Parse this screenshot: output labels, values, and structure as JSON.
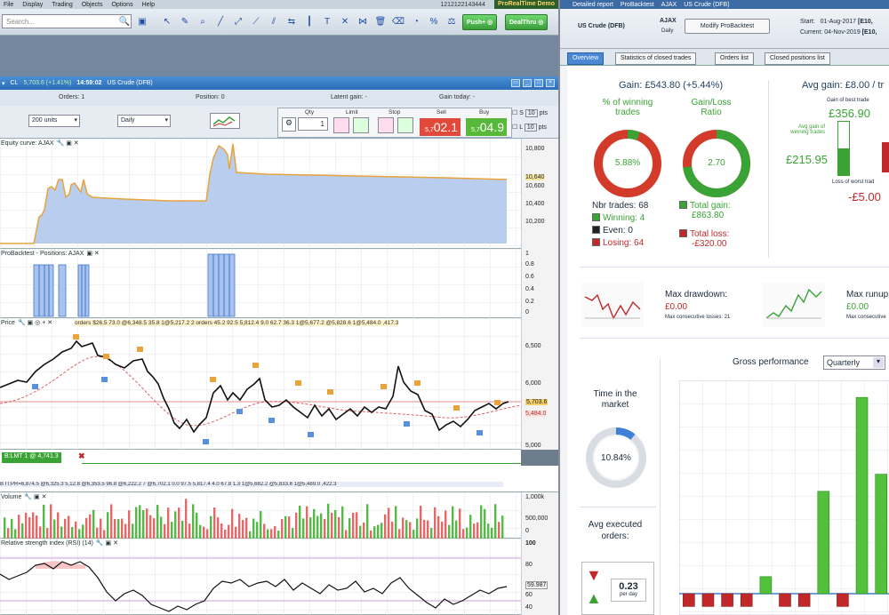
{
  "menu": {
    "items": [
      "File",
      "Display",
      "Trading",
      "Objects",
      "Options",
      "Help"
    ],
    "id": "1212122143444",
    "brand": "ProRealTime Demo"
  },
  "toolbar": {
    "search_placeholder": "Search...",
    "push_label": "Push+ ◎",
    "dealthru_label": "DealThru ◎"
  },
  "chartwin": {
    "symbol": "CL",
    "quote": "5,703.6 (+1.41%)",
    "time": "14:59:02",
    "name": "US Crude (DFB)"
  },
  "orders": {
    "orders_label": "Orders: 1",
    "position_label": "Position: 0",
    "latent_label": "Latent gain: -",
    "gaintoday_label": "Gain today: -"
  },
  "controls": {
    "units": "200 units",
    "period": "Daily"
  },
  "ticket": {
    "qty_label": "Qty",
    "limit_label": "Limit",
    "stop_label": "Stop",
    "sell_label": "Sell",
    "buy_label": "Buy",
    "qty_value": "1",
    "sell_prefix": "5,7",
    "sell_value": "02.1",
    "buy_prefix": "5,7",
    "buy_value": "04.9",
    "s_label": "S",
    "l_label": "L",
    "pts": "pts",
    "s_pts": "10",
    "l_pts": "10"
  },
  "panels": {
    "equity_title": "Equity curve: AJAX",
    "positions_title": "ProBacktest - Positions: AJAX",
    "price_title": "Price",
    "price_orders": "orders  $26.5 73.0  @6,348.5 35.8    1@5,217.2  2 orders 45.2 92.5 5,812.4 9.0 62.7 36.3   1@5,677.2 @5,828.6   1@5,484.0 ,417.3",
    "blmt_label": "B:LMT 1 @ 4,741.3",
    "orders2": "B IT:PR=6,874.5  @6,325.3 5,12.8  @6,353.5 96.8   @6,222.2 7 @6,702.1 0.0 97.5 5,817.4 4.0 67.8 1.3   1@5,682.2 @5,833.6   1@5,489.0 ,422.3",
    "volume_title": "Volume",
    "rsi_title": "Relative strength index (RSI) (14)"
  },
  "axes": {
    "equity": [
      "10,800",
      "10,640",
      "10,600",
      "10,400",
      "10,200"
    ],
    "positions": [
      "1",
      "0.8",
      "0.6",
      "0.4",
      "0.2",
      "0"
    ],
    "price": [
      "6,500",
      "6,000",
      "5,703.6",
      "5,484.0",
      "5,000"
    ],
    "volume": [
      "1,000k",
      "500,000",
      "0"
    ],
    "rsi": [
      "100",
      "80",
      "59.987",
      "60",
      "40"
    ]
  },
  "right": {
    "tabs_head": [
      "Detailed report",
      "ProBacktest",
      "AJAX",
      "US Crude (DFB)"
    ],
    "instrument": "US Crude (DFB)",
    "system": "AJAX",
    "system_sub": "Daily",
    "modify_btn": "Modify ProBacktest",
    "start_label": "Start:",
    "start_date": "01-Aug-2017",
    "start_val": "[E10,",
    "current_label": "Current:",
    "current_date": "04-Nov-2019",
    "current_val": "[E10,",
    "report_tabs": [
      "Overview",
      "Statistics of closed trades",
      "Orders list",
      "Closed positions list"
    ],
    "gain": "Gain: £543.80 (+5.44%)",
    "pct_winning_title": "% of winning trades",
    "pct_winning": "5.88%",
    "gainloss_title": "Gain/Loss Ratio",
    "gainloss": "2.70",
    "nbr_trades": "Nbr trades: 68",
    "winning": "Winning: 4",
    "even": "Even: 0",
    "losing": "Losing: 64",
    "total_gain_label": "Total gain:",
    "total_gain": "£863.80",
    "total_loss_label": "Total loss:",
    "total_loss": "-£320.00",
    "avg_gain_title": "Avg gain: £8.00 / tr",
    "best_label": "Gain of best trade",
    "best_value": "£356.90",
    "avg_winning_label": "Avg gain of winning trades",
    "avg_winning": "£215.95",
    "worst_label": "Loss of worst trad",
    "worst_value": "-£5.00",
    "max_dd_label": "Max drawdown:",
    "max_dd": "£0.00",
    "max_consec_losses": "Max consecutive losses: 21",
    "max_ru_label": "Max runup",
    "max_ru": "£0.00",
    "max_consec_wins": "Max consecutive",
    "time_market_title": "Time in the market",
    "time_market": "10.84%",
    "avg_exec_title": "Avg executed orders:",
    "avg_exec": "0.23",
    "per_day": "per day",
    "gross_title": "Gross performance",
    "gross_period": "Quarterly"
  },
  "gross_chart": {
    "values": [
      -3,
      -3,
      -3,
      -3,
      4,
      -3,
      -3,
      24,
      -3,
      46,
      28
    ],
    "ylim": [
      -5,
      50
    ]
  },
  "win_pct": 5.88,
  "gl_ratio_fill": 73,
  "time_pct": 10.84,
  "colors": {
    "accent": "#4a88d6",
    "win": "#3aa336",
    "loss": "#c0282a"
  }
}
